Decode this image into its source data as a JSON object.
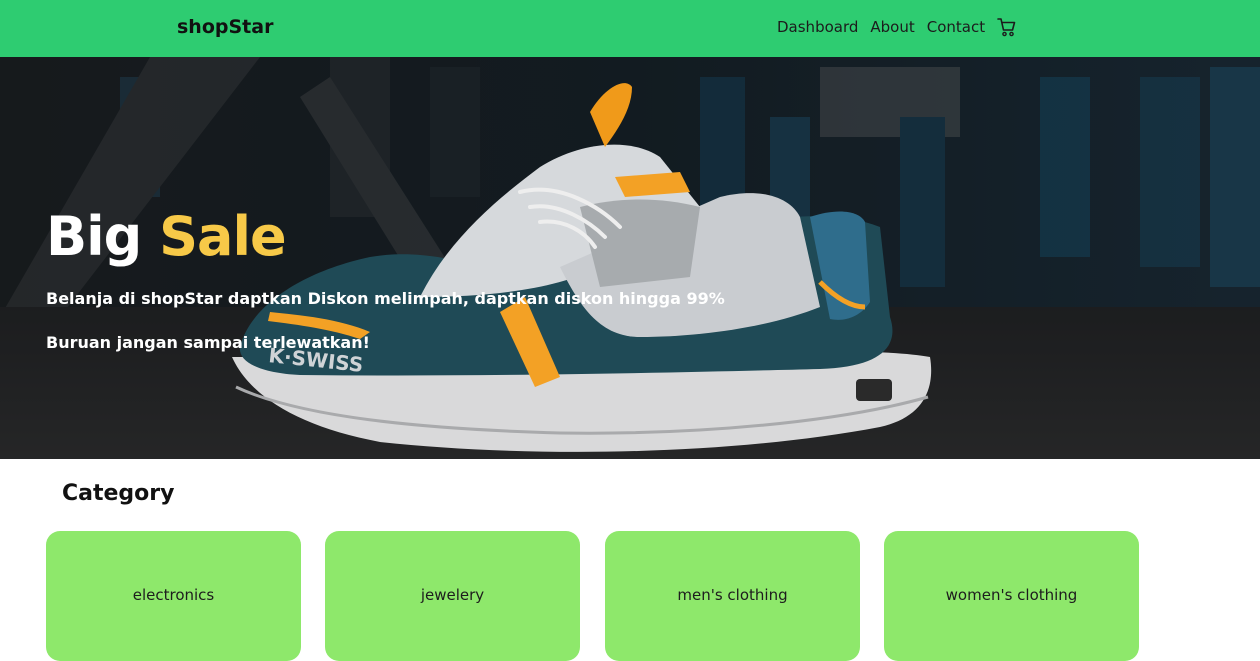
{
  "navbar": {
    "brand": "shopStar",
    "links": [
      "Dashboard",
      "About",
      "Contact"
    ],
    "cart_icon": "cart-icon"
  },
  "hero": {
    "title_word1": "Big",
    "title_word2": "Sale",
    "line1": "Belanja di shopStar daptkan Diskon melimpah, daptkan diskon hingga 99%",
    "line2": "Buruan jangan sampai terlewatkan!",
    "image_subject": "K-SWISS sneaker on asphalt",
    "shoe_brand_text": "K·SWISS",
    "accent_color": "#f7c948"
  },
  "category": {
    "title": "Category",
    "items": [
      "electronics",
      "jewelery",
      "men's clothing",
      "women's clothing"
    ],
    "card_color": "#8ee86b"
  },
  "colors": {
    "navbar": "#2ecc71"
  }
}
